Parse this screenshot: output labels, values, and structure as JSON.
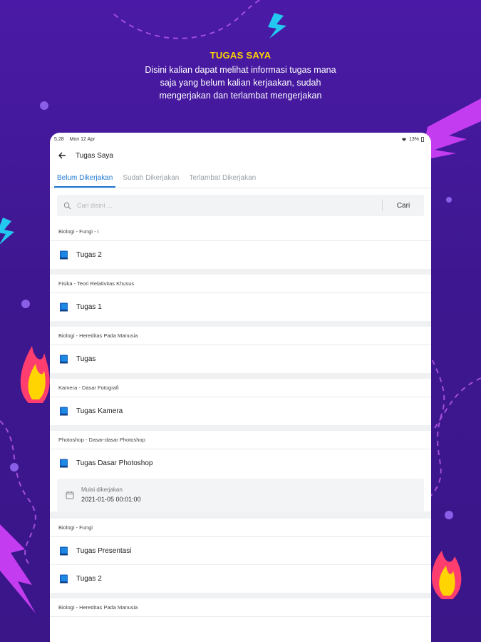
{
  "promo": {
    "title": "TUGAS SAYA",
    "lines": [
      "Disini kalian dapat melihat informasi tugas mana",
      "saja yang belum kalian kerjaakan, sudah",
      "mengerjakan dan terlambat mengerjakan"
    ]
  },
  "status": {
    "time": "5.28",
    "date": "Mon 12 Apr",
    "battery": "13%"
  },
  "appbar": {
    "title": "Tugas Saya"
  },
  "tabs": [
    {
      "label": "Belum Dikerjakan"
    },
    {
      "label": "Sudah Dikerjakan"
    },
    {
      "label": "Terlambat Dikerjakan"
    }
  ],
  "search": {
    "placeholder": "Cari disini ...",
    "button": "Cari"
  },
  "groups": [
    {
      "header": "Biologi - Fungi - I",
      "tasks": [
        "Tugas 2"
      ]
    },
    {
      "header": "Fisika - Teori Relativitas Khusus",
      "tasks": [
        "Tugas 1"
      ]
    },
    {
      "header": "Biologi - Hereditas Pada Manusia",
      "tasks": [
        "Tugas"
      ]
    },
    {
      "header": "Kamera - Dasar Fotografi",
      "tasks": [
        "Tugas Kamera"
      ]
    },
    {
      "header": "Photoshop - Dasar-dasar Photoshop",
      "tasks": [
        "Tugas Dasar Photoshop"
      ],
      "detail": {
        "label": "Mulai dikerjakan",
        "value": "2021-01-05 00:01:00"
      }
    },
    {
      "header": "Biologi - Fungi",
      "tasks": [
        "Tugas Presentasi",
        "Tugas 2"
      ]
    },
    {
      "header": "Biologi - Hereditas Pada Manusia",
      "tasks": []
    }
  ],
  "colors": {
    "accent": "#1f78d1",
    "background": "#4a1aa6",
    "headline": "#ffd400"
  },
  "icons": {
    "back": "arrow-left-icon",
    "search": "search-icon",
    "task": "book-icon",
    "calendar": "calendar-icon"
  }
}
